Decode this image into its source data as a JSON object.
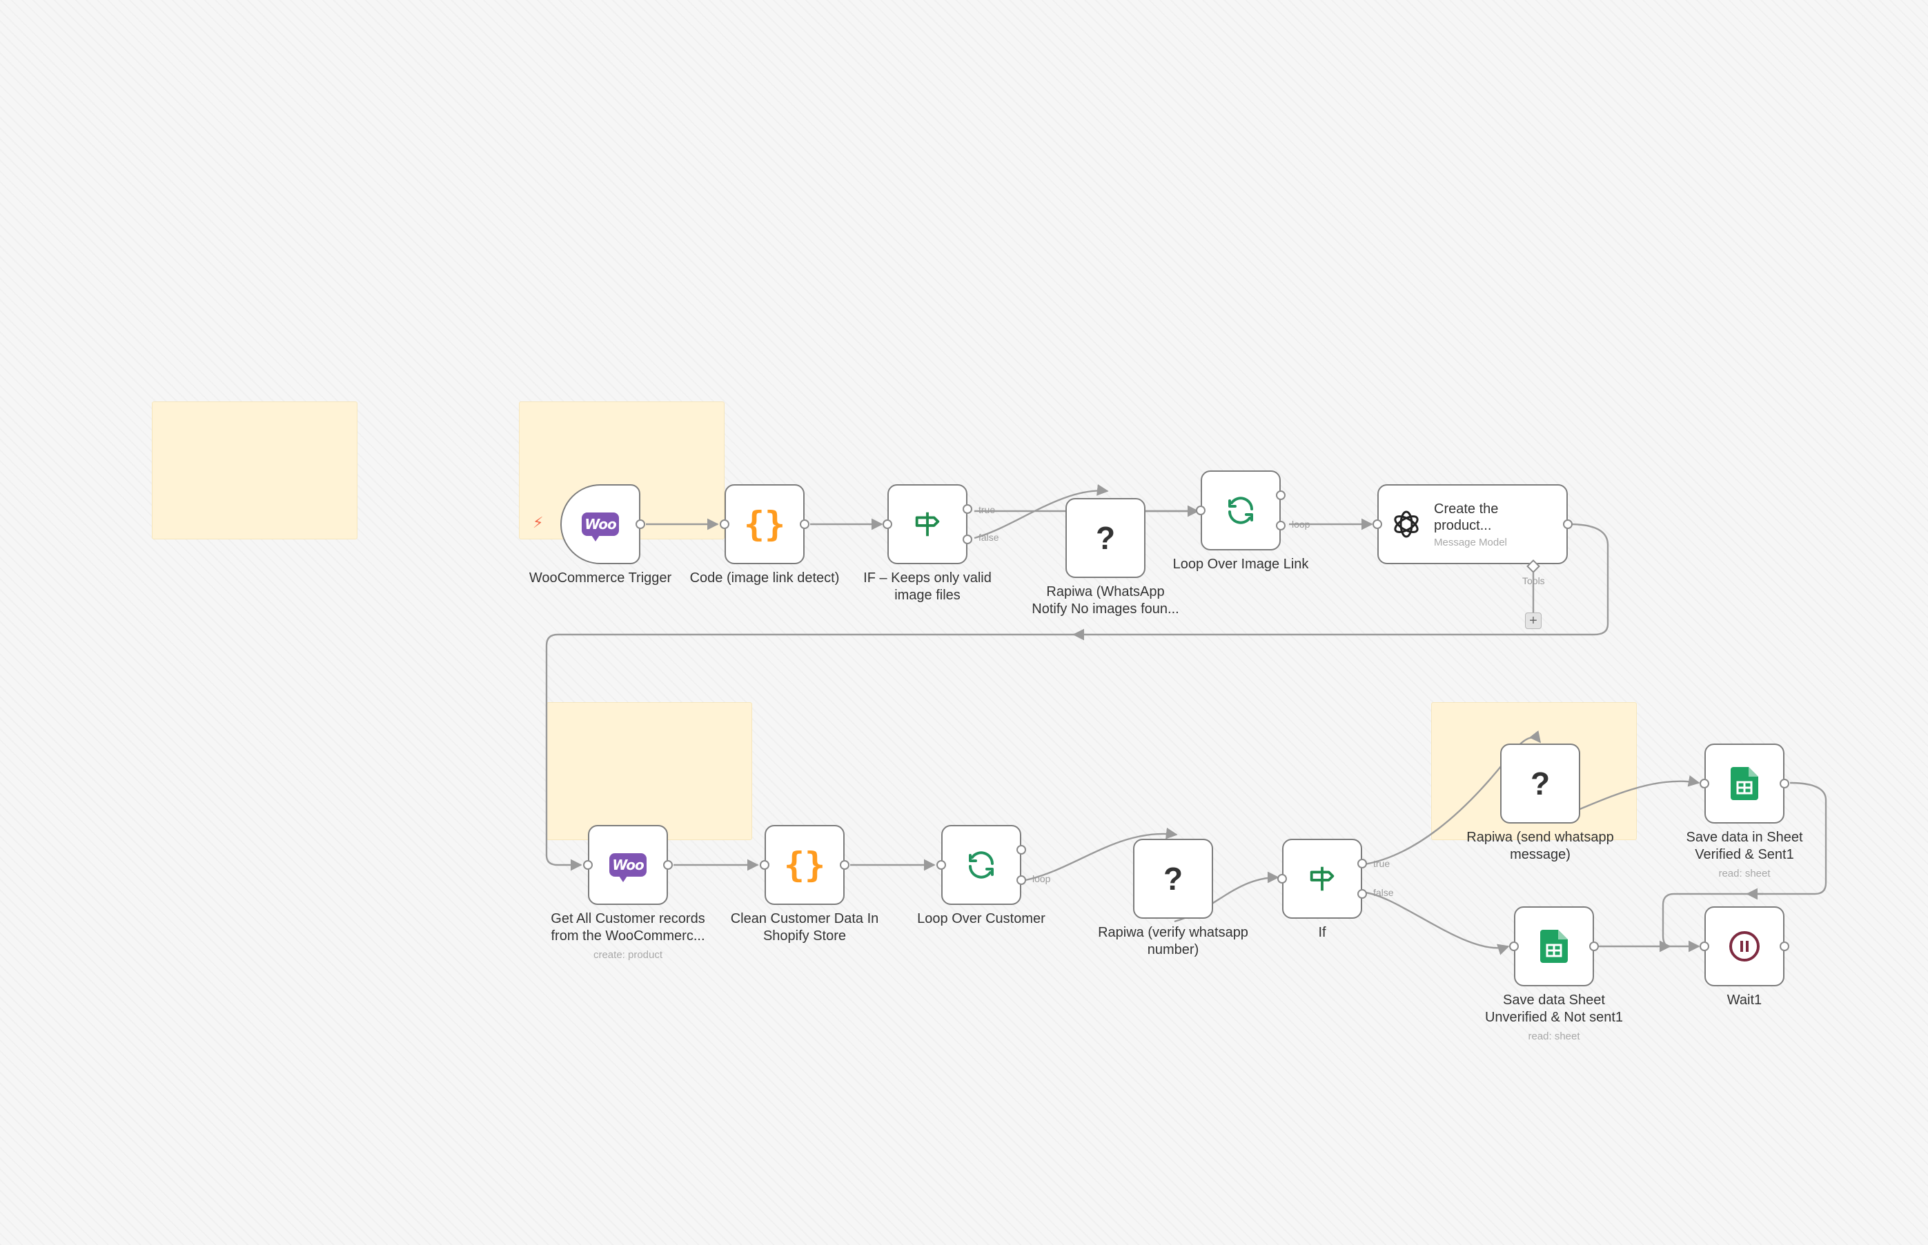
{
  "canvas": {
    "nodes": {
      "woo_trigger": {
        "label": "WooCommerce Trigger",
        "icon": "woocommerce-icon"
      },
      "code_image": {
        "label": "Code (image link detect)",
        "icon": "code-braces-icon"
      },
      "if_valid": {
        "label1": "IF – Keeps only valid",
        "label2": "image files",
        "icon": "if-signpost-icon",
        "port_true": "true",
        "port_false": "false"
      },
      "rapiwa_notify": {
        "label1": "Rapiwa (WhatsApp",
        "label2": "Notify No images foun...",
        "icon": "question-icon"
      },
      "loop_image": {
        "label": "Loop Over Image Link",
        "icon": "loop-icon",
        "port_loop": "loop"
      },
      "openai_create": {
        "title1": "Create the",
        "title2": "product...",
        "subtitle": "Message Model",
        "icon": "openai-icon",
        "tools_label": "Tools"
      },
      "get_customers": {
        "label1": "Get All Customer records",
        "label2": "from the WooCommerc...",
        "sub": "create: product",
        "icon": "woocommerce-icon"
      },
      "clean_customer": {
        "label1": "Clean Customer Data In",
        "label2": "Shopify Store",
        "icon": "code-braces-icon"
      },
      "loop_customer": {
        "label": "Loop Over Customer",
        "icon": "loop-icon",
        "port_loop": "loop"
      },
      "rapiwa_verify": {
        "label1": "Rapiwa (verify whatsapp",
        "label2": "number)",
        "icon": "question-icon"
      },
      "if_node": {
        "label": "If",
        "icon": "if-signpost-icon",
        "port_true": "true",
        "port_false": "false"
      },
      "rapiwa_send": {
        "label1": "Rapiwa (send whatsapp",
        "label2": "message)",
        "icon": "question-icon"
      },
      "sheet_verified": {
        "label1": "Save data in Sheet",
        "label2": "Verified & Sent1",
        "sub": "read: sheet",
        "icon": "google-sheets-icon"
      },
      "sheet_unverified": {
        "label1": "Save data Sheet",
        "label2": "Unverified & Not sent1",
        "sub": "read: sheet",
        "icon": "google-sheets-icon"
      },
      "wait": {
        "label": "Wait1",
        "icon": "pause-icon"
      }
    },
    "colors": {
      "sticky": "#fff3d6",
      "woocommerce": "#7f54b3",
      "code": "#ff9b1e",
      "if": "#1f8a4c",
      "loop": "#21935e",
      "sheets": "#1ea362",
      "wait": "#7d2a40",
      "trigger_bolt": "#f36b4c"
    }
  }
}
